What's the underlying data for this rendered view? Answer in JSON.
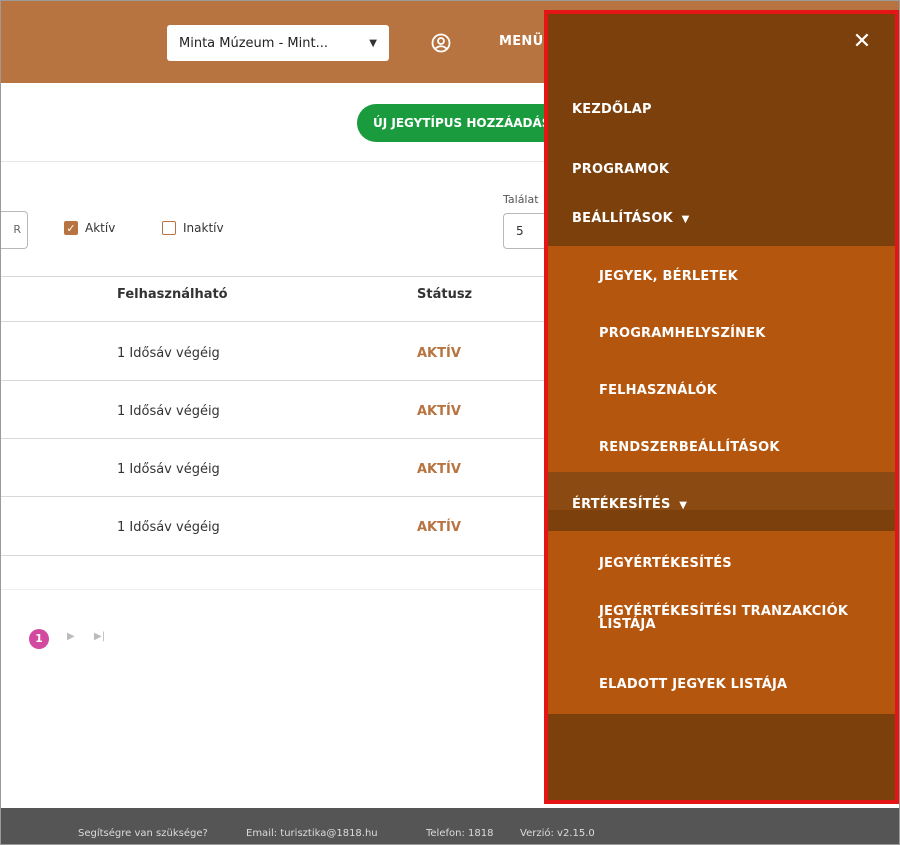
{
  "header": {
    "museum_select": "Minta Múzeum - Mint...",
    "menu_label": "MENÜ"
  },
  "main": {
    "add_button": "ÚJ JEGYTÍPUS HOZZÁADÁSA",
    "filters": {
      "search_stub": "R",
      "active_label": "Aktív",
      "active_checked": true,
      "inactive_label": "Inaktív",
      "inactive_checked": false,
      "results_label": "Találat",
      "results_value": "5"
    },
    "table": {
      "columns": [
        "Felhasználható",
        "Státusz"
      ],
      "rows": [
        {
          "usable": "1 Idősáv végéig",
          "status": "AKTÍV"
        },
        {
          "usable": "1 Idősáv végéig",
          "status": "AKTÍV"
        },
        {
          "usable": "1 Idősáv végéig",
          "status": "AKTÍV"
        },
        {
          "usable": "1 Idősáv végéig",
          "status": "AKTÍV"
        }
      ]
    },
    "pagination": {
      "current_page": "1"
    }
  },
  "sidemenu": {
    "items": [
      {
        "label": "KEZDŐLAP"
      },
      {
        "label": "PROGRAMOK"
      },
      {
        "label": "BEÁLLÍTÁSOK",
        "expanded": true,
        "children": [
          "JEGYEK, BÉRLETEK",
          "PROGRAMHELYSZÍNEK",
          "FELHASZNÁLÓK",
          "RENDSZERBEÁLLÍTÁSOK"
        ]
      },
      {
        "label": "ÉRTÉKESÍTÉS",
        "expanded": true,
        "children": [
          "JEGYÉRTÉKESÍTÉS",
          "JEGYÉRTÉKESÍTÉSI TRANZAKCIÓK LISTÁJA",
          "ELADOTT JEGYEK LISTÁJA"
        ]
      }
    ]
  },
  "footer": {
    "help": "Segítségre van szüksége?",
    "email": "Email: turisztika@1818.hu",
    "phone": "Telefon: 1818",
    "version": "Verzió: v2.15.0"
  },
  "colors": {
    "header": "#b87440",
    "menu_dark": "#7c400c",
    "menu_sub": "#b5560e",
    "add_button": "#1a9b3e",
    "status": "#b87440",
    "highlight_border": "#e31515"
  }
}
